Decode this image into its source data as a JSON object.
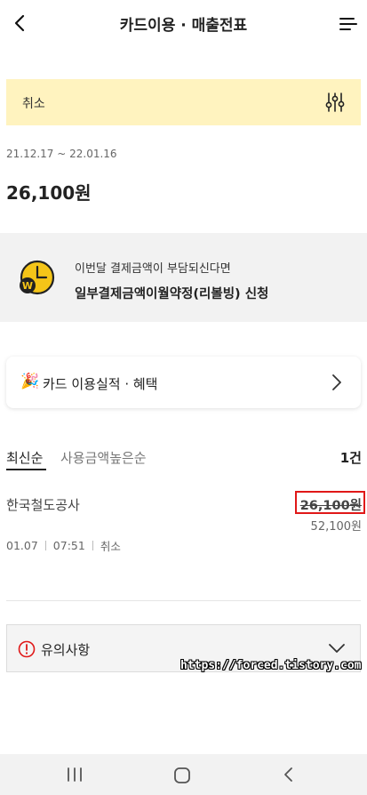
{
  "header": {
    "title": "카드이용 · 매출전표"
  },
  "filter": {
    "label": "취소"
  },
  "summary": {
    "date_range": "21.12.17 ~ 22.01.16",
    "total": "26,100원"
  },
  "promo": {
    "sub": "이번달 결제금액이 부담되신다면",
    "main": "일부결제금액이월약정(리볼빙) 신청"
  },
  "benefit": {
    "emoji": "🎉",
    "label": "카드 이용실적 · 혜택"
  },
  "sort": {
    "latest": "최신순",
    "amount": "사용금액높은순",
    "count": "1건"
  },
  "transaction": {
    "merchant": "한국철도공사",
    "amount_cancelled": "26,100원",
    "amount_sub": "52,100원",
    "date": "01.07",
    "time": "07:51",
    "status": "취소"
  },
  "notice": {
    "label": "유의사항"
  },
  "watermark": "https://forced.tistory.com",
  "colors": {
    "accent_yellow": "#fff3bf",
    "highlight_red": "#e01818",
    "icon_yellow": "#f5c518"
  },
  "icons": {
    "back": "back-arrow-icon",
    "menu": "menu-icon",
    "filter": "filter-sliders-icon",
    "promo": "clock-coin-icon",
    "benefit_arrow": "chevron-right-icon",
    "notice": "info-icon",
    "notice_toggle": "chevron-down-icon",
    "nav_recent": "recent-apps-icon",
    "nav_home": "home-icon",
    "nav_back": "nav-back-icon"
  }
}
